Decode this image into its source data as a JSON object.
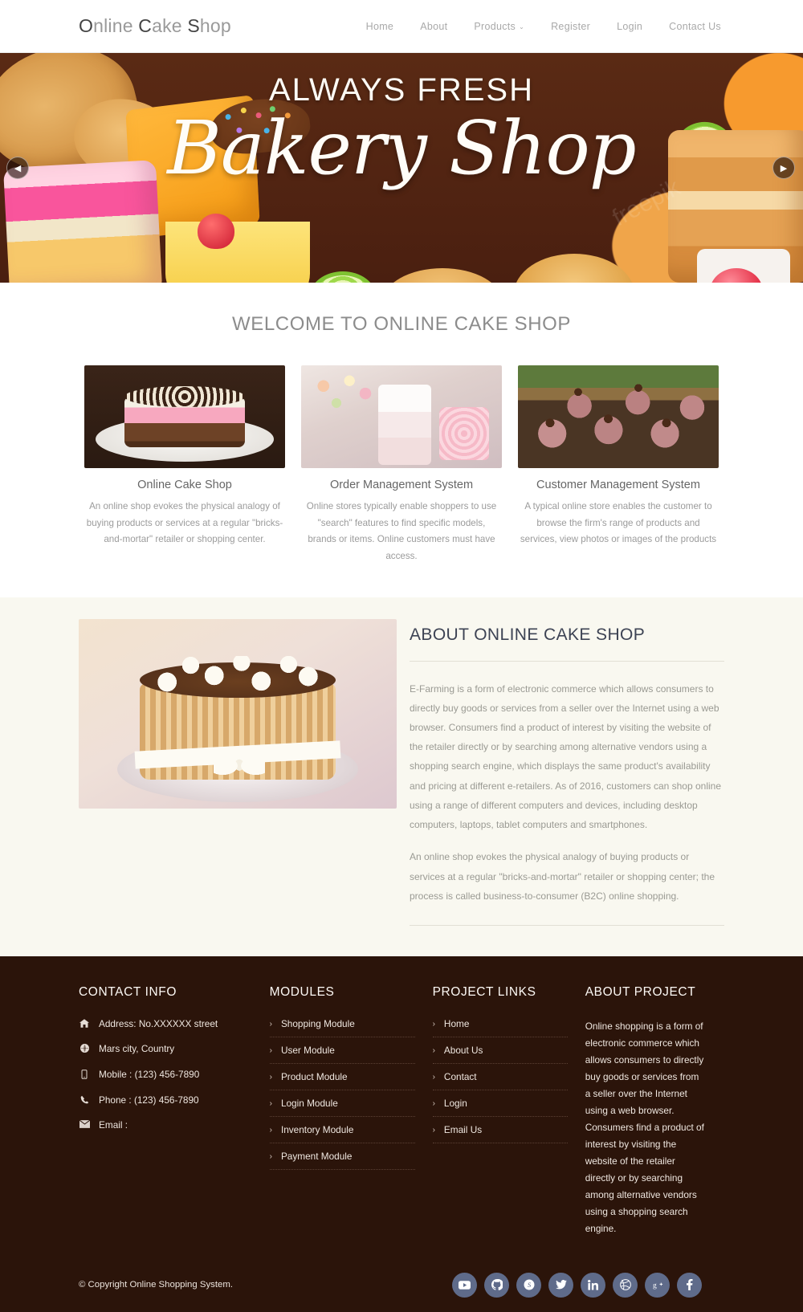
{
  "header": {
    "logo_pre": "O",
    "logo": "Online Cake Shop",
    "nav": [
      {
        "label": "Home",
        "caret": ""
      },
      {
        "label": "About",
        "caret": ""
      },
      {
        "label": "Products",
        "caret": "⌄"
      },
      {
        "label": "Register",
        "caret": ""
      },
      {
        "label": "Login",
        "caret": ""
      },
      {
        "label": "Contact Us",
        "caret": ""
      }
    ]
  },
  "hero": {
    "kicker": "ALWAYS FRESH",
    "script": "Bakery Shop",
    "watermark": "freepik",
    "prev_icon": "◀",
    "next_icon": "▶"
  },
  "welcome": {
    "title": "WELCOME TO ONLINE CAKE SHOP",
    "cards": [
      {
        "title": "Online Cake Shop",
        "text": "An online shop evokes the physical analogy of buying products or services at a regular \"bricks-and-mortar\" retailer or shopping center."
      },
      {
        "title": "Order Management System",
        "text": "Online stores typically enable shoppers to use \"search\" features to find specific models, brands or items. Online customers must have access."
      },
      {
        "title": "Customer Management System",
        "text": "A typical online store enables the customer to browse the firm's range of products and services, view photos or images of the products"
      }
    ]
  },
  "about": {
    "heading": "ABOUT ONLINE CAKE SHOP",
    "paragraph1": "E-Farming is a form of electronic commerce which allows consumers to directly buy goods or services from a seller over the Internet using a web browser. Consumers find a product of interest by visiting the website of the retailer directly or by searching among alternative vendors using a shopping search engine, which displays the same product's availability and pricing at different e-retailers. As of 2016, customers can shop online using a range of different computers and devices, including desktop computers, laptops, tablet computers and smartphones.",
    "paragraph2": "An online shop evokes the physical analogy of buying products or services at a regular \"bricks-and-mortar\" retailer or shopping center; the process is called business-to-consumer (B2C) online shopping."
  },
  "footer": {
    "contact": {
      "heading": "CONTACT INFO",
      "rows": [
        {
          "icon": "home-icon",
          "text": "Address: No.XXXXXX street"
        },
        {
          "icon": "globe-icon",
          "text": "Mars city, Country"
        },
        {
          "icon": "mobile-icon",
          "text": "Mobile : (123) 456-7890"
        },
        {
          "icon": "phone-icon",
          "text": "Phone : (123) 456-7890"
        },
        {
          "icon": "envelope-icon",
          "text": "Email :"
        }
      ]
    },
    "modules": {
      "heading": "MODULES",
      "items": [
        "Shopping Module",
        "User Module",
        "Product Module",
        "Login Module",
        "Inventory Module",
        "Payment Module"
      ]
    },
    "project_links": {
      "heading": "PROJECT LINKS",
      "items": [
        "Home",
        "About Us",
        "Contact",
        "Login",
        "Email Us"
      ]
    },
    "about_project": {
      "heading": "ABOUT PROJECT",
      "text": "Online shopping is a form of electronic commerce which allows consumers to directly buy goods or services from a seller over the Internet using a web browser. Consumers find a product of interest by visiting the website of the retailer directly or by searching among alternative vendors using a shopping search engine."
    },
    "copyright": "© Copyright Online Shopping System.",
    "socials": [
      {
        "name": "youtube-icon",
        "glyph": "▶"
      },
      {
        "name": "github-icon",
        "glyph": ""
      },
      {
        "name": "skype-icon",
        "glyph": "S"
      },
      {
        "name": "twitter-icon",
        "glyph": ""
      },
      {
        "name": "linkedin-icon",
        "glyph": "in"
      },
      {
        "name": "dribbble-icon",
        "glyph": ""
      },
      {
        "name": "googleplus-icon",
        "glyph": "g+"
      },
      {
        "name": "facebook-icon",
        "glyph": "f"
      }
    ],
    "chevron": "›"
  },
  "colors": {
    "footer_bg": "#2b140a",
    "about_bg": "#f9f8f0",
    "social_bg": "#5f6b8a",
    "about_heading": "#3d4354"
  }
}
